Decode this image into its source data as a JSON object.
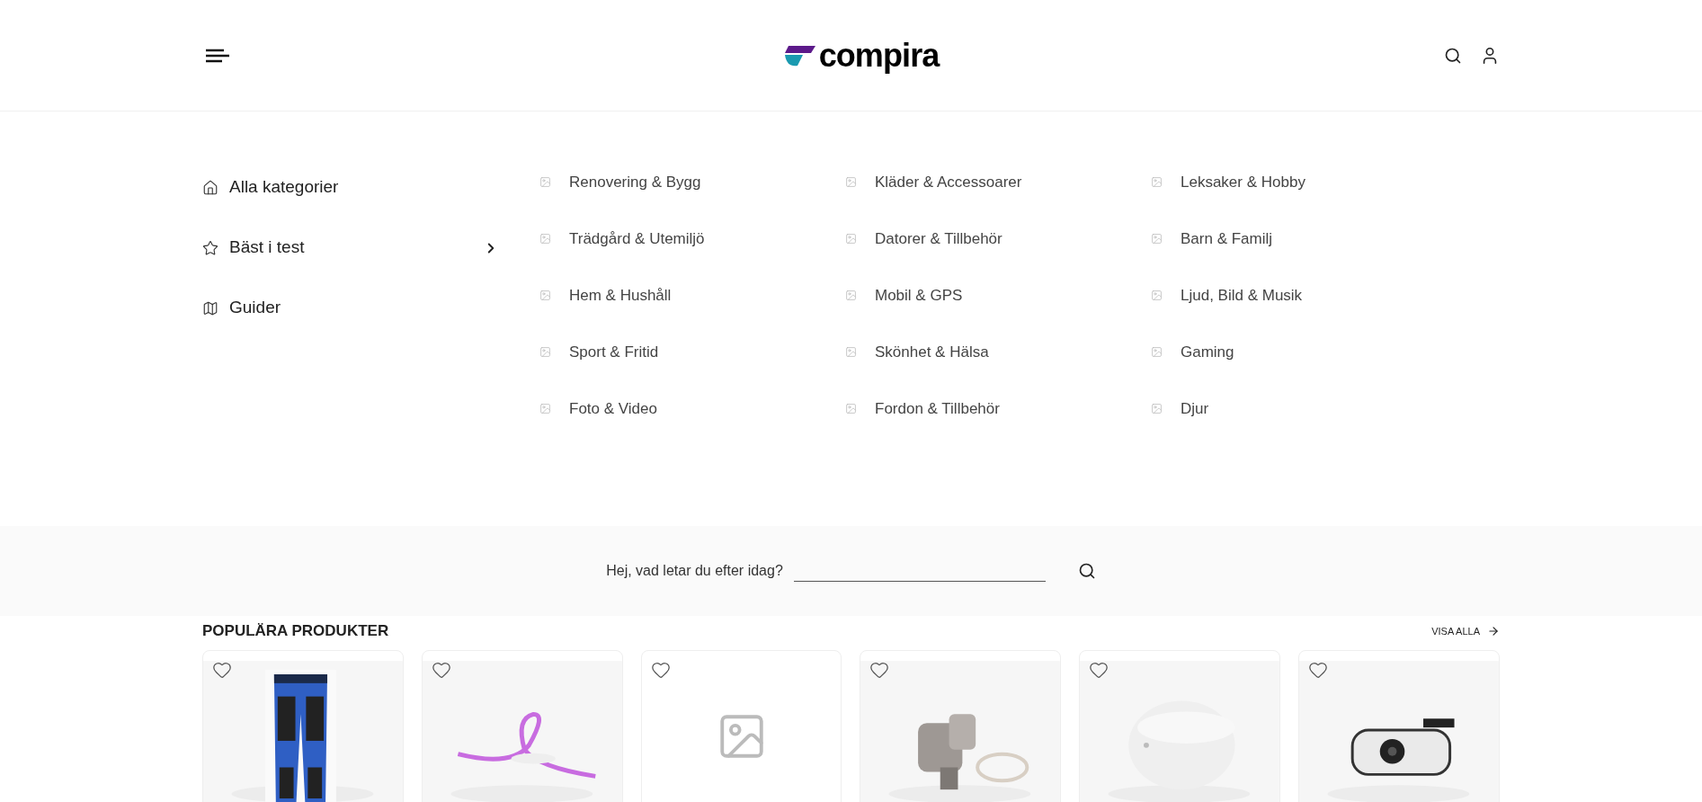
{
  "header": {
    "logo": "compira"
  },
  "menu": {
    "items": [
      {
        "label": "Alla kategorier",
        "has_submenu": false
      },
      {
        "label": "Bäst i test",
        "has_submenu": true
      },
      {
        "label": "Guider",
        "has_submenu": false
      }
    ],
    "categories": [
      [
        "Renovering & Bygg",
        "Trädgård & Utemiljö",
        "Hem & Hushåll",
        "Sport & Fritid",
        "Foto & Video"
      ],
      [
        "Kläder & Accessoarer",
        "Datorer & Tillbehör",
        "Mobil & GPS",
        "Skönhet & Hälsa",
        "Fordon & Tillbehör"
      ],
      [
        "Leksaker & Hobby",
        "Barn & Familj",
        "Ljud, Bild & Musik",
        "Gaming",
        "Djur"
      ]
    ]
  },
  "search": {
    "label": "Hej, vad letar du efter idag?"
  },
  "popular": {
    "title": "POPULÄRA PRODUKTER",
    "link": "VISA ALLA",
    "products": [
      {
        "kind": "picture"
      },
      {
        "kind": "picture"
      },
      {
        "kind": "placeholder"
      },
      {
        "kind": "picture"
      },
      {
        "kind": "picture"
      },
      {
        "kind": "picture"
      }
    ]
  }
}
